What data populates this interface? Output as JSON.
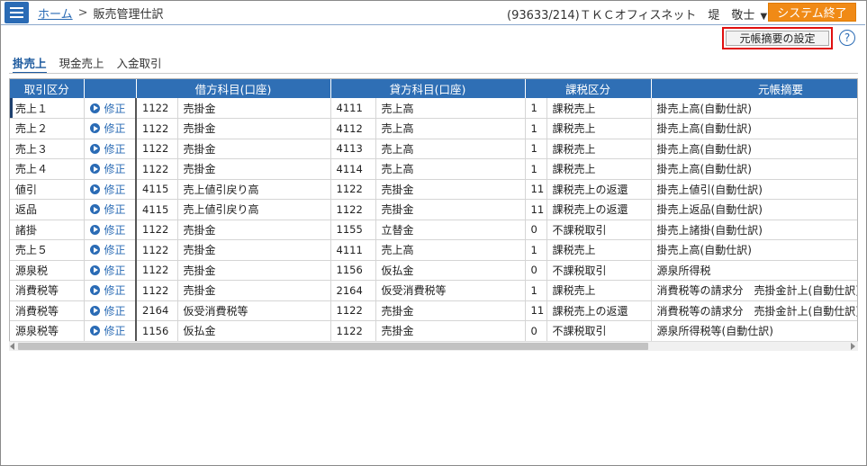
{
  "header": {
    "home_label": "ホーム",
    "separator": ">",
    "current_page": "販売管理仕訳",
    "user_info": "(93633/214)ＴＫＣオフィスネット　堤　敬士",
    "exit_label": "システム終了"
  },
  "toolbar": {
    "settings_label": "元帳摘要の設定",
    "help_glyph": "?"
  },
  "tabs": [
    {
      "label": "掛売上",
      "active": true
    },
    {
      "label": "現金売上",
      "active": false
    },
    {
      "label": "入金取引",
      "active": false
    }
  ],
  "table": {
    "headers": {
      "kind": "取引区分",
      "debit": "借方科目(口座)",
      "credit": "貸方科目(口座)",
      "tax": "課税区分",
      "summary": "元帳摘要"
    },
    "edit_label": "修正",
    "rows": [
      {
        "kind": "売上１",
        "debit_code": "1122",
        "debit_name": "売掛金",
        "credit_code": "4111",
        "credit_name": "売上高",
        "tax_code": "1",
        "tax_name": "課税売上",
        "summary": "掛売上高(自動仕訳)"
      },
      {
        "kind": "売上２",
        "debit_code": "1122",
        "debit_name": "売掛金",
        "credit_code": "4112",
        "credit_name": "売上高",
        "tax_code": "1",
        "tax_name": "課税売上",
        "summary": "掛売上高(自動仕訳)"
      },
      {
        "kind": "売上３",
        "debit_code": "1122",
        "debit_name": "売掛金",
        "credit_code": "4113",
        "credit_name": "売上高",
        "tax_code": "1",
        "tax_name": "課税売上",
        "summary": "掛売上高(自動仕訳)"
      },
      {
        "kind": "売上４",
        "debit_code": "1122",
        "debit_name": "売掛金",
        "credit_code": "4114",
        "credit_name": "売上高",
        "tax_code": "1",
        "tax_name": "課税売上",
        "summary": "掛売上高(自動仕訳)"
      },
      {
        "kind": "値引",
        "debit_code": "4115",
        "debit_name": "売上値引戻り高",
        "credit_code": "1122",
        "credit_name": "売掛金",
        "tax_code": "11",
        "tax_name": "課税売上の返還",
        "summary": "掛売上値引(自動仕訳)"
      },
      {
        "kind": "返品",
        "debit_code": "4115",
        "debit_name": "売上値引戻り高",
        "credit_code": "1122",
        "credit_name": "売掛金",
        "tax_code": "11",
        "tax_name": "課税売上の返還",
        "summary": "掛売上返品(自動仕訳)"
      },
      {
        "kind": "諸掛",
        "debit_code": "1122",
        "debit_name": "売掛金",
        "credit_code": "1155",
        "credit_name": "立替金",
        "tax_code": "0",
        "tax_name": "不課税取引",
        "summary": "掛売上諸掛(自動仕訳)"
      },
      {
        "kind": "売上５",
        "debit_code": "1122",
        "debit_name": "売掛金",
        "credit_code": "4111",
        "credit_name": "売上高",
        "tax_code": "1",
        "tax_name": "課税売上",
        "summary": "掛売上高(自動仕訳)"
      },
      {
        "kind": "源泉税",
        "debit_code": "1122",
        "debit_name": "売掛金",
        "credit_code": "1156",
        "credit_name": "仮払金",
        "tax_code": "0",
        "tax_name": "不課税取引",
        "summary": "源泉所得税"
      },
      {
        "kind": "消費税等",
        "debit_code": "1122",
        "debit_name": "売掛金",
        "credit_code": "2164",
        "credit_name": "仮受消費税等",
        "tax_code": "1",
        "tax_name": "課税売上",
        "summary": "消費税等の請求分　売掛金計上(自動仕訳)"
      },
      {
        "kind": "消費税等",
        "debit_code": "2164",
        "debit_name": "仮受消費税等",
        "credit_code": "1122",
        "credit_name": "売掛金",
        "tax_code": "11",
        "tax_name": "課税売上の返還",
        "summary": "消費税等の請求分　売掛金計上(自動仕訳)"
      },
      {
        "kind": "源泉税等",
        "debit_code": "1156",
        "debit_name": "仮払金",
        "credit_code": "1122",
        "credit_name": "売掛金",
        "tax_code": "0",
        "tax_name": "不課税取引",
        "summary": "源泉所得税等(自動仕訳)"
      }
    ]
  }
}
